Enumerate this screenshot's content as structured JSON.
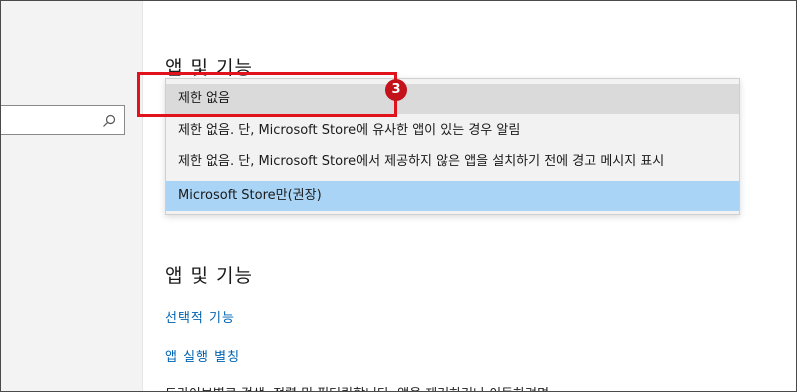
{
  "section": {
    "top_title": "앱 및 기능",
    "title": "앱 및 기능"
  },
  "dropdown": {
    "options": [
      "제한 없음",
      "제한 없음. 단, Microsoft Store에 유사한 앱이 있는 경우 알림",
      "제한 없음. 단, Microsoft Store에서 제공하지 않은 앱을 설치하기 전에 경고 메시지 표시",
      "Microsoft Store만(권장)"
    ],
    "selected_index": 3,
    "hovered_index": 0
  },
  "annotation": {
    "step_number": "3",
    "box_color": "#e1121b"
  },
  "links": {
    "optional_features": "선택적 기능",
    "app_aliases": "앱 실행 별칭"
  },
  "description": "드라이브별로 검색, 정렬 및 필터링합니다. 앱을 제거하거나 이동하려면",
  "colors": {
    "link": "#0063b1",
    "selected_option": "#a9d4f5",
    "hovered_option": "#dadada"
  }
}
